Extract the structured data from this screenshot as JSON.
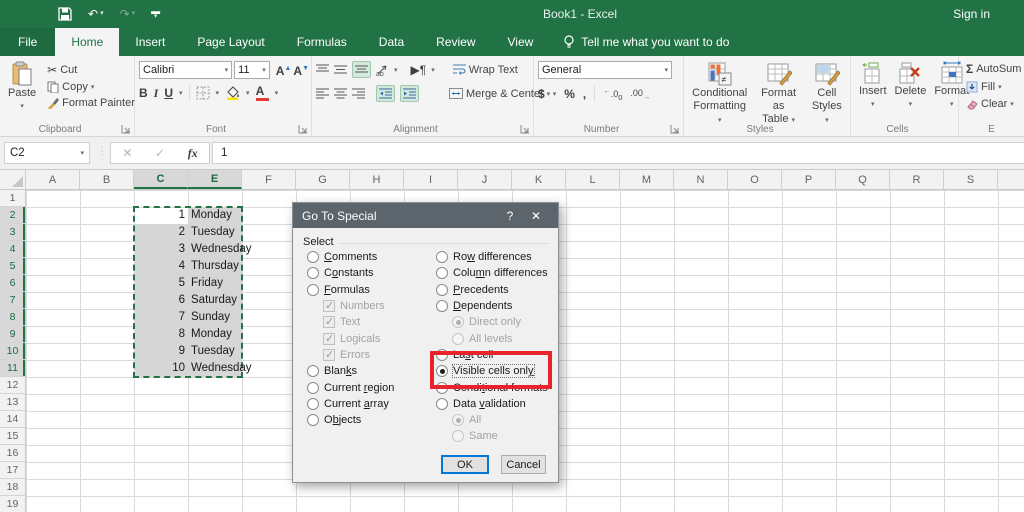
{
  "colors": {
    "brand_green": "#217346",
    "tab_active_bg": "#f4f4f4",
    "selection_gray": "#d6d6d6",
    "annotation_red": "#e8232b",
    "dialog_title_bg": "#5c646c",
    "focus_blue": "#0078d7"
  },
  "titlebar": {
    "title": "Book1  -  Excel",
    "sign_in": "Sign in",
    "qat_icons": [
      "save-icon",
      "undo-icon",
      "redo-icon",
      "customize-qat-icon"
    ]
  },
  "tabs": {
    "file": "File",
    "items": [
      "Home",
      "Insert",
      "Page Layout",
      "Formulas",
      "Data",
      "Review",
      "View"
    ],
    "active": "Home",
    "tell_me": "Tell me what you want to do"
  },
  "ribbon": {
    "clipboard": {
      "label": "Clipboard",
      "paste": "Paste",
      "cut": "Cut",
      "copy": "Copy",
      "format_painter": "Format Painter"
    },
    "font": {
      "label": "Font",
      "family": "Calibri",
      "size": "11",
      "bold": "B",
      "italic": "I",
      "underline": "U"
    },
    "alignment": {
      "label": "Alignment",
      "wrap_text": "Wrap Text",
      "merge_center": "Merge & Center"
    },
    "number": {
      "label": "Number",
      "format": "General",
      "currency": "$",
      "percent": "%",
      "comma": ","
    },
    "styles": {
      "label": "Styles",
      "conditional1": "Conditional",
      "conditional2": "Formatting",
      "format_table1": "Format as",
      "format_table2": "Table",
      "cell_styles1": "Cell",
      "cell_styles2": "Styles"
    },
    "cells": {
      "label": "Cells",
      "insert": "Insert",
      "delete": "Delete",
      "format": "Format"
    },
    "editing": {
      "label_partial": "E",
      "autosum": "AutoSum",
      "fill": "Fill",
      "clear": "Clear"
    }
  },
  "formula_bar": {
    "name_box": "C2",
    "fx": "fx",
    "cancel": "✕",
    "enter": "✓",
    "value": "1"
  },
  "sheet": {
    "columns": [
      "A",
      "B",
      "C",
      "E",
      "F",
      "G",
      "H",
      "I",
      "J",
      "K",
      "L",
      "M",
      "N",
      "O",
      "P",
      "Q",
      "R",
      "S"
    ],
    "selected_columns": [
      "C",
      "E"
    ],
    "hidden_columns": [
      "D"
    ],
    "row_count": 19,
    "selected_row_start": 2,
    "selected_row_end": 11,
    "active_cell": "C2",
    "numbers": [
      "1",
      "2",
      "3",
      "4",
      "5",
      "6",
      "7",
      "8",
      "9",
      "10"
    ],
    "days": [
      "Monday",
      "Tuesday",
      "Wednesday",
      "Thursday",
      "Friday",
      "Saturday",
      "Sunday",
      "Monday",
      "Tuesday",
      "Wednesday"
    ]
  },
  "dialog": {
    "title": "Go To Special",
    "help": "?",
    "close": "✕",
    "group_label": "Select",
    "left_options": [
      {
        "label": "Comments",
        "accel": 0
      },
      {
        "label": "Constants",
        "accel": 1
      },
      {
        "label": "Formulas",
        "accel": 0
      },
      {
        "label": "Numbers",
        "type": "check",
        "sub": true,
        "disabled": true,
        "checked": true
      },
      {
        "label": "Text",
        "type": "check",
        "sub": true,
        "disabled": true,
        "checked": true
      },
      {
        "label": "Logicals",
        "type": "check",
        "sub": true,
        "disabled": true,
        "checked": true
      },
      {
        "label": "Errors",
        "type": "check",
        "sub": true,
        "disabled": true,
        "checked": true
      },
      {
        "label": "Blanks",
        "accel": 4
      },
      {
        "label": "Current region",
        "accel": 8
      },
      {
        "label": "Current array",
        "accel": 8
      },
      {
        "label": "Objects",
        "accel": 1
      }
    ],
    "right_options": [
      {
        "label": "Row differences",
        "accel": 2
      },
      {
        "label": "Column differences",
        "accel": 4
      },
      {
        "label": "Precedents",
        "accel": 0
      },
      {
        "label": "Dependents",
        "accel": 0
      },
      {
        "label": "Direct only",
        "sub": true,
        "disabled": true,
        "selected": true
      },
      {
        "label": "All levels",
        "sub": true,
        "disabled": true
      },
      {
        "label": "Last cell",
        "accel": 2
      },
      {
        "label": "Visible cells only",
        "accel": 17,
        "selected": true,
        "focus": true
      },
      {
        "label": "Conditional formats",
        "accel": 5
      },
      {
        "label": "Data validation",
        "accel": 5
      },
      {
        "label": "All",
        "sub": true,
        "disabled": true,
        "selected": true
      },
      {
        "label": "Same",
        "sub": true,
        "disabled": true
      }
    ],
    "ok": "OK",
    "cancel": "Cancel"
  }
}
